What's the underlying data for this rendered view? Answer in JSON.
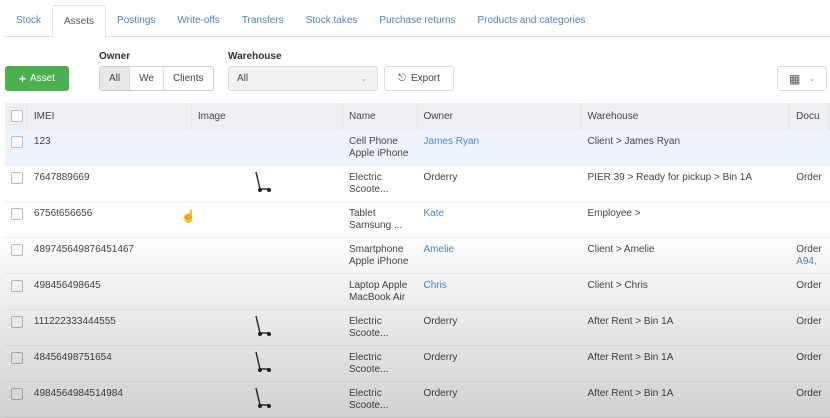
{
  "tabs": [
    "Stock",
    "Assets",
    "Postings",
    "Write-offs",
    "Transfers",
    "Stock takes",
    "Purchase returns",
    "Products and categories"
  ],
  "toolbar": {
    "add_label": "Asset",
    "owner_label": "Owner",
    "owner_options": [
      "All",
      "We",
      "Clients"
    ],
    "warehouse_label": "Warehouse",
    "warehouse_value": "All",
    "export_label": "Export"
  },
  "columns": [
    "IMEI",
    "Image",
    "Name",
    "Owner",
    "Warehouse",
    "Docu"
  ],
  "rows": [
    {
      "imei": "123",
      "image": false,
      "name": "Cell Phone Apple iPhone ...",
      "owner": "James Ryan",
      "owner_link": true,
      "warehouse": "Client > James Ryan",
      "doc": "",
      "doc2": ""
    },
    {
      "imei": "7647889669",
      "image": true,
      "name": "Electric Scoote...",
      "owner": "Orderry",
      "owner_link": false,
      "warehouse": "PIER 39 > Ready for pickup > Bin 1A",
      "doc": "Order",
      "doc2": ""
    },
    {
      "imei": "6756t656656",
      "image": false,
      "name": "Tablet Samsung ...",
      "owner": "Kate",
      "owner_link": true,
      "warehouse": "Employee >",
      "doc": "",
      "doc2": ""
    },
    {
      "imei": "489745649876451467",
      "image": false,
      "name": "Smartphone Apple iPhone ...",
      "owner": "Amelie",
      "owner_link": true,
      "warehouse": "Client > Amelie",
      "doc": "Order",
      "doc2": "A94, "
    },
    {
      "imei": "498456498645",
      "image": false,
      "name": "Laptop Apple MacBook Air ...",
      "owner": "Chris",
      "owner_link": true,
      "warehouse": "Client > Chris",
      "doc": "Order",
      "doc2": ""
    },
    {
      "imei": "111222333444555",
      "image": true,
      "name": "Electric Scoote...",
      "owner": "Orderry",
      "owner_link": false,
      "warehouse": "After Rent > Bin 1A",
      "doc": "Order",
      "doc2": ""
    },
    {
      "imei": "48456498751654",
      "image": true,
      "name": "Electric Scoote...",
      "owner": "Orderry",
      "owner_link": false,
      "warehouse": "After Rent > Bin 1A",
      "doc": "Order",
      "doc2": ""
    },
    {
      "imei": "4984564984514984",
      "image": true,
      "name": "Electric Scoote...",
      "owner": "Orderry",
      "owner_link": false,
      "warehouse": "After Rent > Bin 1A",
      "doc": "Order",
      "doc2": ""
    }
  ]
}
